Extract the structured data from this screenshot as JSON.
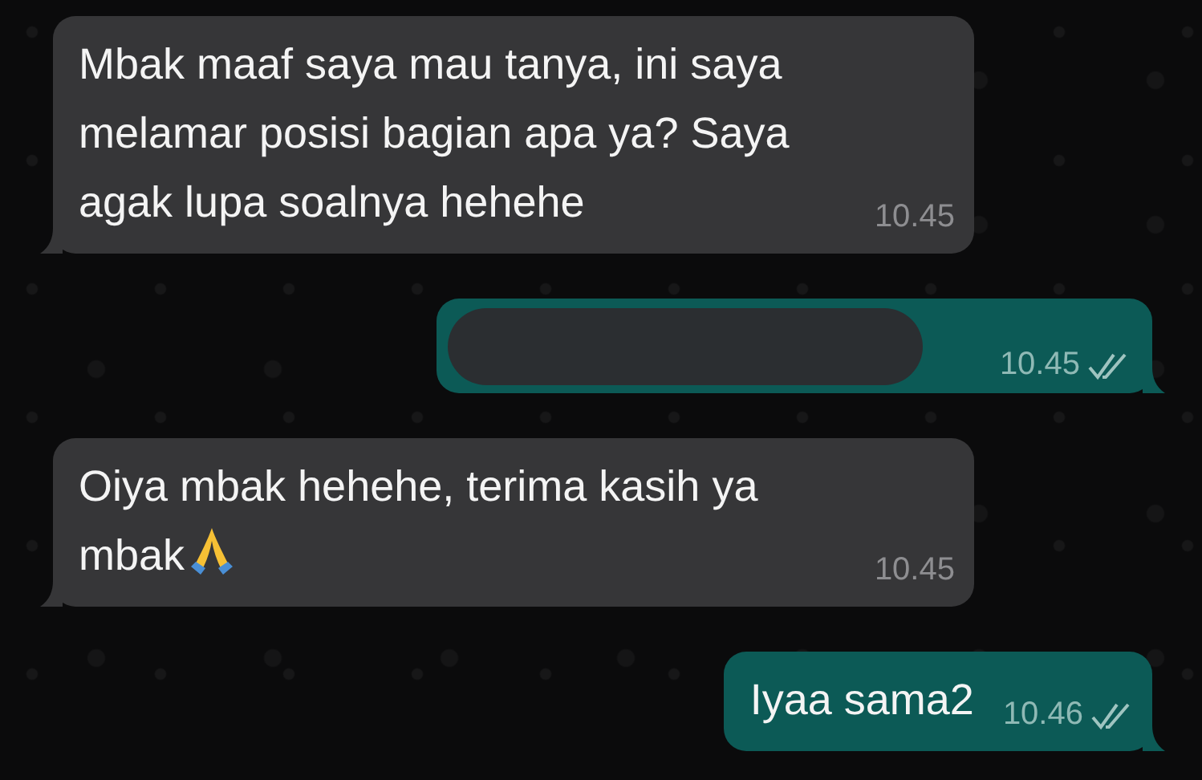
{
  "messages": [
    {
      "kind": "incoming",
      "text": "Mbak maaf saya mau tanya, ini saya melamar posisi bagian apa ya? Saya agak lupa soalnya hehehe",
      "time": "10.45"
    },
    {
      "kind": "outgoing",
      "redacted": true,
      "time": "10.45",
      "read": false
    },
    {
      "kind": "incoming",
      "text": "Oiya mbak hehehe, terima kasih ya mbak",
      "pray_icon": true,
      "time": "10.45"
    },
    {
      "kind": "outgoing",
      "text": "Iyaa sama2",
      "time": "10.46",
      "read": false
    }
  ]
}
